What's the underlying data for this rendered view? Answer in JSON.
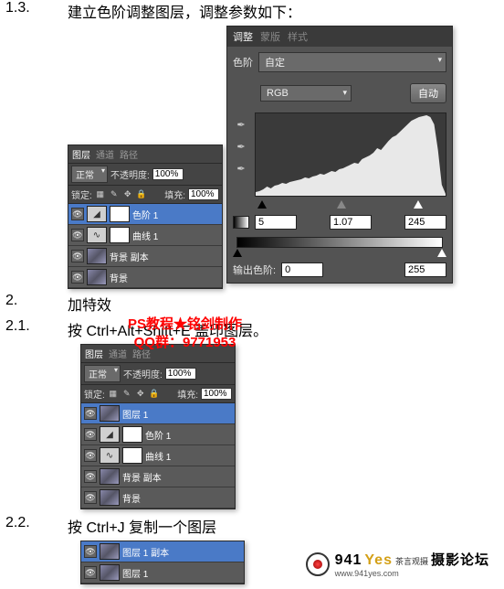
{
  "steps": {
    "s1_3_num": "1.3.",
    "s1_3_text": "建立色阶调整图层，调整参数如下：",
    "s2_num": "2.",
    "s2_text": "加特效",
    "s2_1_num": "2.1.",
    "s2_1_text": "按 Ctrl+Alt+Shift+E 盖印图层。",
    "s2_2_num": "2.2.",
    "s2_2_text": "按 Ctrl+J 复制一个图层"
  },
  "layers_panel_1": {
    "tabs": [
      "图层",
      "通道",
      "路径"
    ],
    "blend": "正常",
    "opacity_label": "不透明度:",
    "opacity_value": "100%",
    "lock_label": "锁定:",
    "fill_label": "填充:",
    "fill_value": "100%",
    "items": [
      {
        "name": "色阶 1",
        "adj": true,
        "adj_glyph": "◢",
        "selected": true
      },
      {
        "name": "曲线 1",
        "adj": true,
        "adj_glyph": "∿",
        "selected": false
      },
      {
        "name": "背景 副本",
        "adj": false,
        "selected": false
      },
      {
        "name": "背景",
        "adj": false,
        "selected": false
      }
    ]
  },
  "layers_panel_2": {
    "tabs": [
      "图层",
      "通道",
      "路径"
    ],
    "blend": "正常",
    "opacity_label": "不透明度:",
    "opacity_value": "100%",
    "lock_label": "锁定:",
    "fill_label": "填充:",
    "fill_value": "100%",
    "items": [
      {
        "name": "图层 1",
        "adj": false,
        "selected": true
      },
      {
        "name": "色阶 1",
        "adj": true,
        "adj_glyph": "◢",
        "selected": false
      },
      {
        "name": "曲线 1",
        "adj": true,
        "adj_glyph": "∿",
        "selected": false
      },
      {
        "name": "背景 副本",
        "adj": false,
        "selected": false
      },
      {
        "name": "背景",
        "adj": false,
        "selected": false
      }
    ]
  },
  "layers_panel_3": {
    "items": [
      {
        "name": "图层 1 副本",
        "selected": true
      },
      {
        "name": "图层 1",
        "selected": false
      }
    ]
  },
  "adjustments": {
    "tabs": [
      "调整",
      "蒙版",
      "样式"
    ],
    "type_label": "色阶",
    "preset": "自定",
    "channel": "RGB",
    "auto": "自动",
    "black": "5",
    "mid": "1.07",
    "white": "245",
    "output_label": "输出色阶:",
    "out_black": "0",
    "out_white": "255"
  },
  "watermark": {
    "line1": "PS教程★铭剑制作",
    "line2": "QQ群：9771953"
  },
  "footer": {
    "brand_num": "941",
    "brand_suffix": "Yes",
    "tagline": "茶言观摄",
    "forum": "摄影论坛",
    "url": "www.941yes.com"
  }
}
